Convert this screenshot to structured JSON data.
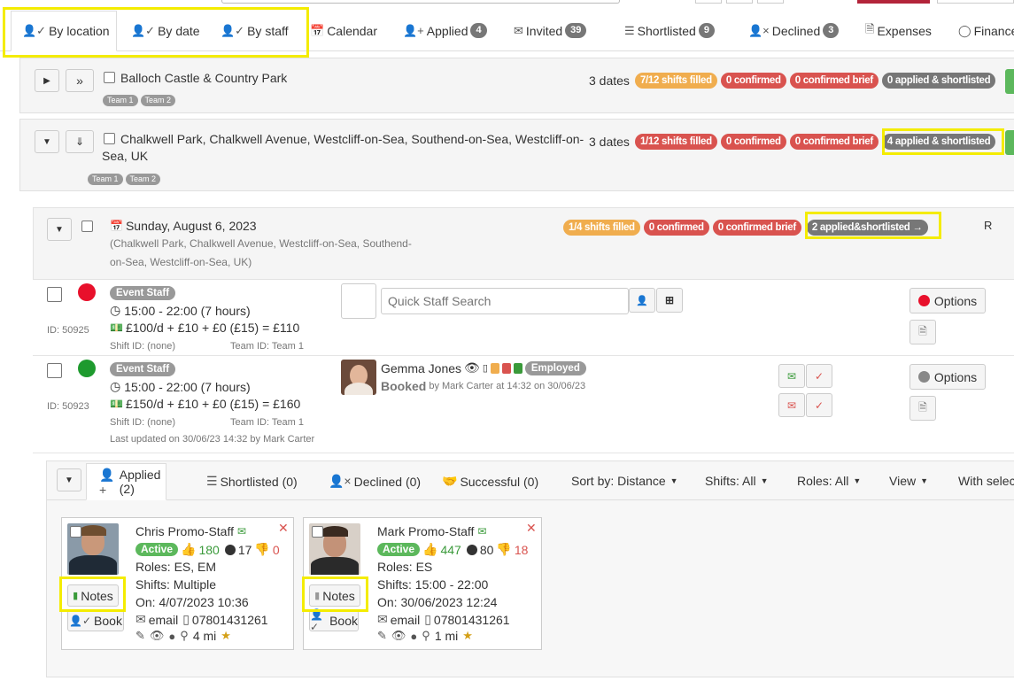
{
  "tabs": [
    {
      "label": "By location",
      "icon": "user-check-icon"
    },
    {
      "label": "By date",
      "icon": "user-check-icon"
    },
    {
      "label": "By staff",
      "icon": "user-check-icon"
    },
    {
      "label": "Calendar",
      "icon": "calendar-icon"
    },
    {
      "label": "Applied",
      "icon": "user-plus-icon",
      "count": "4"
    },
    {
      "label": "Invited",
      "icon": "envelope-icon",
      "count": "39"
    },
    {
      "label": "Shortlisted",
      "icon": "list-icon",
      "count": "9"
    },
    {
      "label": "Declined",
      "icon": "user-x-icon",
      "count": "3"
    },
    {
      "label": "Expenses",
      "icon": "document-icon"
    },
    {
      "label": "Finance",
      "icon": "coins-icon"
    }
  ],
  "locations": [
    {
      "name": "Balloch Castle & Country Park",
      "teams": [
        "Team 1",
        "Team 2"
      ],
      "dates": "3 dates",
      "shifts": "7/12 shifts filled",
      "confirmed": "0 confirmed",
      "brief": "0 confirmed brief",
      "applied": "0 applied & shortlisted"
    },
    {
      "name_line1": "Chalkwell Park, Chalkwell Avenue, Westcliff-on-Sea, Southend-on-Sea, Westcliff-on-",
      "name_line2": "Sea, UK",
      "teams": [
        "Team 1",
        "Team 2"
      ],
      "dates": "3 dates",
      "shifts": "1/12 shifts filled",
      "confirmed": "0 confirmed",
      "brief": "0 confirmed brief",
      "applied": "4 applied & shortlisted"
    }
  ],
  "date_block": {
    "date": "Sunday, August 6, 2023",
    "address_line1": "(Chalkwell Park, Chalkwell Avenue, Westcliff-on-Sea, Southend-",
    "address_line2": "on-Sea, Westcliff-on-Sea, UK)",
    "shifts": "1/4 shifts filled",
    "confirmed": "0 confirmed",
    "brief": "0 confirmed brief",
    "applied": "2 applied&shortlisted →",
    "right_letter": "R"
  },
  "shifts": [
    {
      "status_color": "#e8102b",
      "role": "Event Staff",
      "time": "15:00 - 22:00 (7 hours)",
      "pay": "£100/d + £10 + £0 (£15) = £110",
      "id": "ID: 50925",
      "shift_id": "Shift ID: (none)",
      "team_id": "Team ID: Team 1",
      "search_placeholder": "Quick Staff Search",
      "options": "Options"
    },
    {
      "status_color": "#1e9a2e",
      "role": "Event Staff",
      "time": "15:00 - 22:00 (7 hours)",
      "pay": "£150/d + £10 + £0 (£15) = £160",
      "id": "ID: 50923",
      "shift_id": "Shift ID: (none)",
      "team_id": "Team ID: Team 1",
      "updated": "Last updated on 30/06/23 14:32 by Mark Carter",
      "staff_name": "Gemma Jones",
      "staff_status": "Employed",
      "booked": "Booked",
      "booked_by": "by Mark Carter at 14:32 on 30/06/23",
      "options": "Options"
    }
  ],
  "applicant_tabs": [
    {
      "label": "Applied (2)",
      "icon": "user-plus-icon"
    },
    {
      "label": "Shortlisted (0)",
      "icon": "list-icon"
    },
    {
      "label": "Declined (0)",
      "icon": "user-x-icon"
    },
    {
      "label": "Successful (0)",
      "icon": "handshake-icon"
    }
  ],
  "applicant_filters": [
    "Sort by: Distance",
    "Shifts: All",
    "Roles: All",
    "View",
    "With selec"
  ],
  "applicants": [
    {
      "name": "Chris Promo-Staff",
      "status": "Active",
      "thumbs_up": "180",
      "dots": "17",
      "thumbs_down": "0",
      "roles": "Roles: ES, EM",
      "shifts": "Shifts: Multiple",
      "on": "On: 4/07/2023 10:36",
      "email": "email",
      "phone": "07801431261",
      "distance": "4 mi",
      "notes": "Notes",
      "book": "Book"
    },
    {
      "name": "Mark Promo-Staff",
      "status": "Active",
      "thumbs_up": "447",
      "dots": "80",
      "thumbs_down": "18",
      "roles": "Roles: ES",
      "shifts": "Shifts: 15:00 - 22:00",
      "on": "On: 30/06/2023 12:24",
      "email": "email",
      "phone": "07801431261",
      "distance": "1 mi",
      "notes": "Notes",
      "book": "Book"
    }
  ],
  "colors": {
    "highlight": "#f4ec00",
    "green": "#5cb85c",
    "red": "#d9534f",
    "orange": "#f0ad4e"
  }
}
